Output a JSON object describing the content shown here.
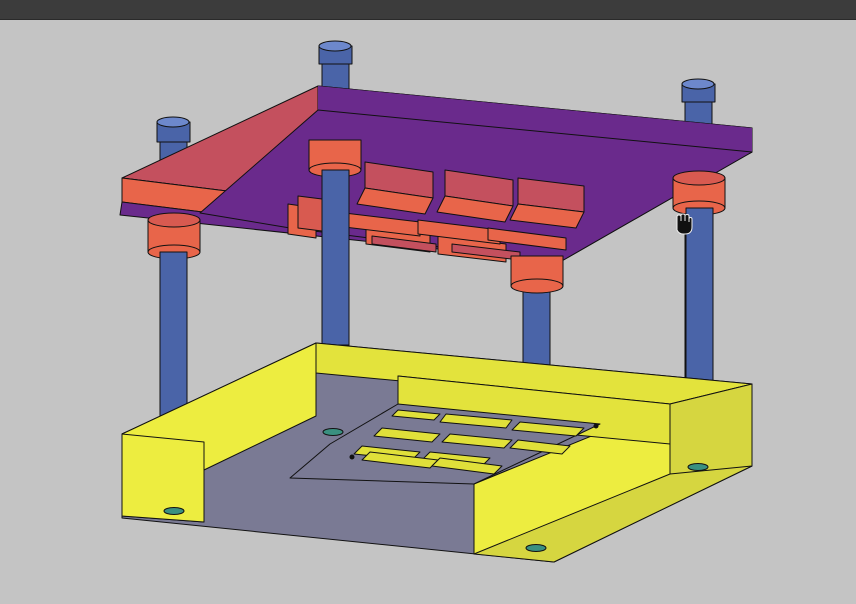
{
  "viewport": {
    "background": "#c4c4c4",
    "titlebar_color": "#3c3c3c",
    "cursor": "hand-pan-cursor"
  },
  "model": {
    "type": "die-set-assembly-3d",
    "guide_post_count": 4,
    "top_plate_pocket_count": 6,
    "bottom_cavity_slot_count": 10,
    "colors": {
      "top_plate_top": "#c4505e",
      "top_plate_front": "#e8654a",
      "top_plate_underside": "#6a2a8c",
      "guide_post": "#4a64a8",
      "guide_post_cap": "#5a78c0",
      "bushing": "#e8654a",
      "punch_block": "#d85a50",
      "bottom_plate_face": "#eded40",
      "bottom_plate_floor": "#7a7a94",
      "cavity": "#e0e03a"
    }
  }
}
